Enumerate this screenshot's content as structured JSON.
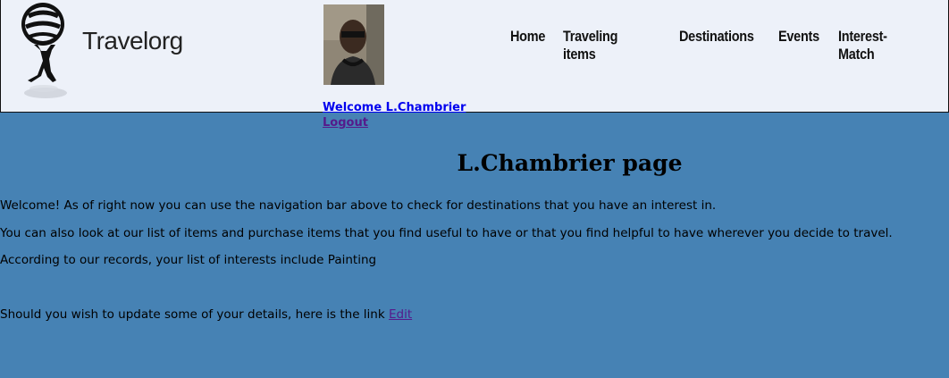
{
  "brand": {
    "name": "Travelorg"
  },
  "nav": {
    "items": [
      {
        "label": "Home"
      },
      {
        "label": "Traveling items"
      },
      {
        "label": "Destinations"
      },
      {
        "label": "Events"
      },
      {
        "label": "Interest-Match"
      }
    ]
  },
  "user": {
    "welcome": "Welcome L.Chambrier",
    "logout": "Logout"
  },
  "main": {
    "title": "L.Chambrier page",
    "para1": "Welcome! As of right now you can use the navigation bar above to check for destinations that you have an interest in.",
    "para2": "You can also look at our list of items and purchase items that you find useful to have or that you find helpful to have wherever you decide to travel.",
    "para3": "According to our records, your list of interests include Painting",
    "para4": "Should you wish to update some of your details, here is the link ",
    "edit_link": "Edit"
  }
}
